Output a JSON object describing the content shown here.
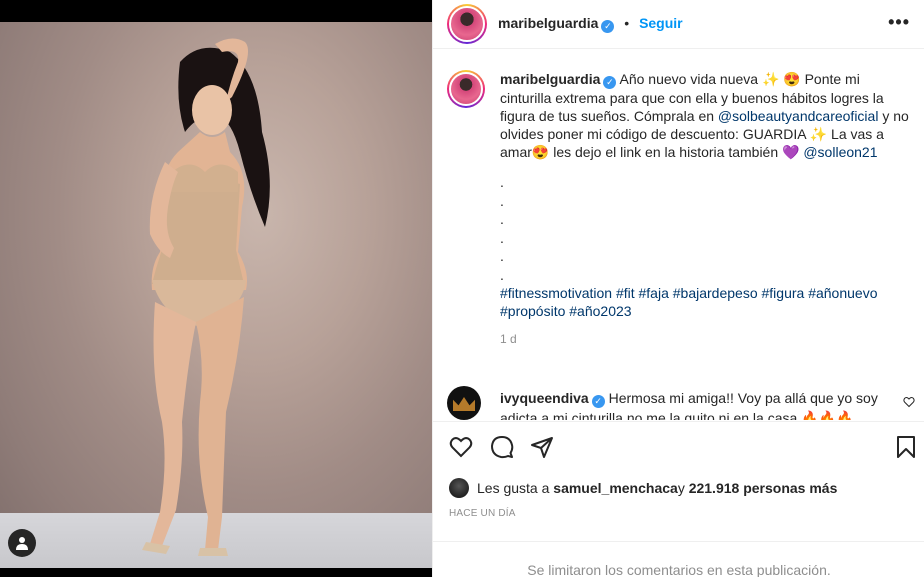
{
  "post": {
    "username": "maribelguardia",
    "follow_label": "Seguir",
    "more_label": "•••",
    "verified_mark": "✓"
  },
  "caption": {
    "username": "maribelguardia",
    "text_1": "Año nuevo vida nueva ✨ 😍 Ponte mi cinturilla extrema para que con ella y buenos hábitos logres la figura de tus sueños. Cómprala en ",
    "mention_1": "@solbeautyandcareoficial",
    "text_2": " y no olvides poner mi código de descuento: GUARDIA ✨ La vas a amar😍 les dejo el link en la historia también 💜 ",
    "mention_2": "@solleon21",
    "dots": [
      ".",
      ".",
      ".",
      ".",
      ".",
      "."
    ],
    "hashtags": "#fitnessmotivation #fit #faja #bajardepeso #figura #añonuevo #propósito #año2023",
    "time": "1 d"
  },
  "reply": {
    "username": "ivyqueendiva",
    "text": "Hermosa mi amiga!! Voy pa allá que yo soy adicta a mi cinturilla no me la quito ni en la casa 🔥🔥🔥"
  },
  "likes": {
    "prefix": "Les gusta a ",
    "user": "samuel_menchaca",
    "middle": " y ",
    "count": "221.918 personas más"
  },
  "posted_ago": "HACE UN DÍA",
  "footer_text": "Se limitaron los comentarios en esta publicación.",
  "colors": {
    "link": "#00376b",
    "follow": "#0095f6",
    "verified": "#3897f0",
    "muted": "#8e8e8e"
  }
}
